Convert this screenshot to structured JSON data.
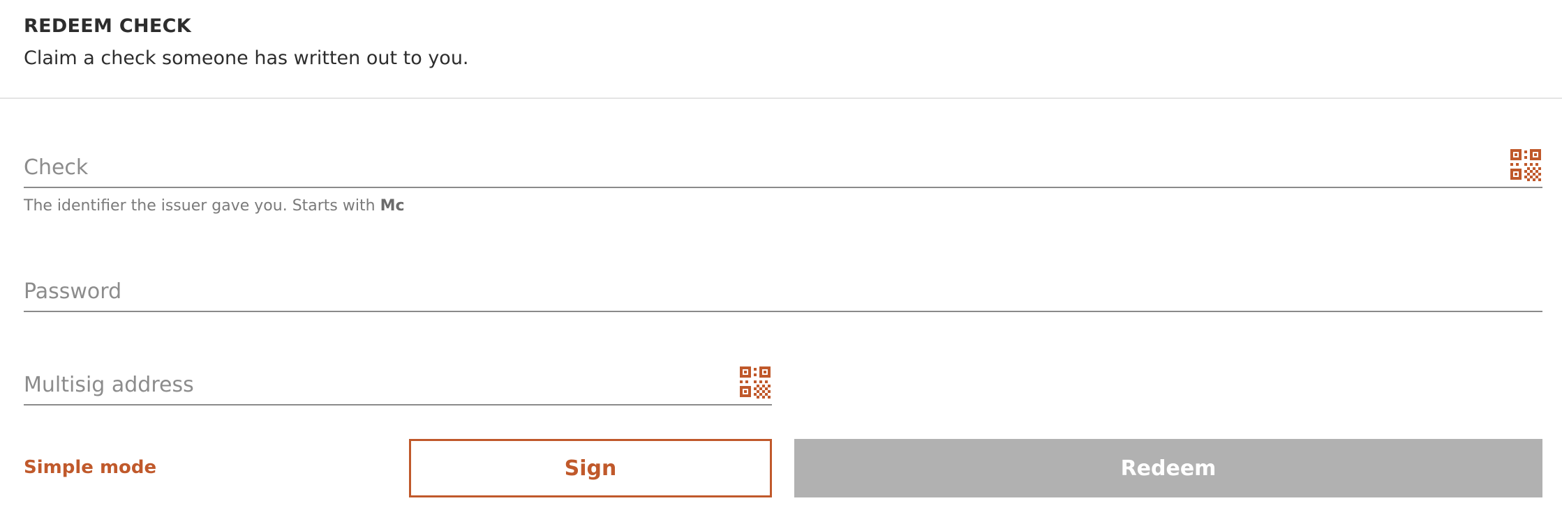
{
  "header": {
    "title": "REDEEM CHECK",
    "subtitle": "Claim a check someone has written out to you."
  },
  "form": {
    "check": {
      "placeholder": "Check",
      "value": "",
      "hint_prefix": "The identifier the issuer gave you. Starts with ",
      "hint_bold": "Mc",
      "scan_icon": "qr-code-icon"
    },
    "password": {
      "placeholder": "Password",
      "value": ""
    },
    "multisig": {
      "placeholder": "Multisig address",
      "value": "",
      "scan_icon": "qr-code-icon"
    }
  },
  "actions": {
    "simple_mode_label": "Simple mode",
    "sign_label": "Sign",
    "redeem_label": "Redeem",
    "redeem_disabled": true
  },
  "colors": {
    "accent": "#c0592b",
    "disabled_button": "#b1b1b1",
    "underline": "#8a8a8a"
  }
}
